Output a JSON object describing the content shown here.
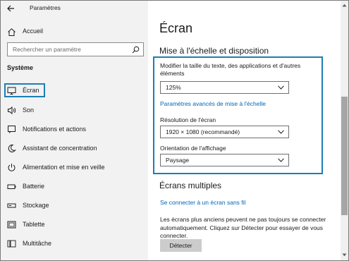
{
  "window": {
    "title": "Paramètres"
  },
  "sidebar": {
    "home_label": "Accueil",
    "search": {
      "placeholder": "Rechercher un paramètre",
      "value": ""
    },
    "section_heading": "Système",
    "items": [
      {
        "label": "Écran",
        "icon": "monitor-icon",
        "selected": true
      },
      {
        "label": "Son",
        "icon": "speaker-icon",
        "selected": false
      },
      {
        "label": "Notifications et actions",
        "icon": "notifications-icon",
        "selected": false
      },
      {
        "label": "Assistant de concentration",
        "icon": "moon-icon",
        "selected": false
      },
      {
        "label": "Alimentation et mise en veille",
        "icon": "power-icon",
        "selected": false
      },
      {
        "label": "Batterie",
        "icon": "battery-icon",
        "selected": false
      },
      {
        "label": "Stockage",
        "icon": "storage-icon",
        "selected": false
      },
      {
        "label": "Tablette",
        "icon": "tablet-icon",
        "selected": false
      },
      {
        "label": "Multitâche",
        "icon": "multitask-icon",
        "selected": false
      }
    ]
  },
  "main": {
    "page_title": "Écran",
    "scale_section": {
      "heading": "Mise à l'échelle et disposition",
      "text_size_label": "Modifier la taille du texte, des applications et d'autres éléments",
      "text_size_value": "125%",
      "advanced_link": "Paramètres avancés de mise à l'échelle",
      "resolution_label": "Résolution de l'écran",
      "resolution_value": "1920 × 1080 (recommandé)",
      "orientation_label": "Orientation de l'affichage",
      "orientation_value": "Paysage"
    },
    "multiple_section": {
      "heading": "Écrans multiples",
      "wireless_link": "Se connecter à un écran sans fil",
      "description": "Les écrans plus anciens peuvent ne pas toujours se connecter automatiquement. Cliquez sur Détecter pour essayer de vous connecter.",
      "detect_button": "Détecter"
    }
  },
  "colors": {
    "accent": "#1a7fb5",
    "link": "#0067b8",
    "sidebar_bg": "#f2f2f2"
  }
}
